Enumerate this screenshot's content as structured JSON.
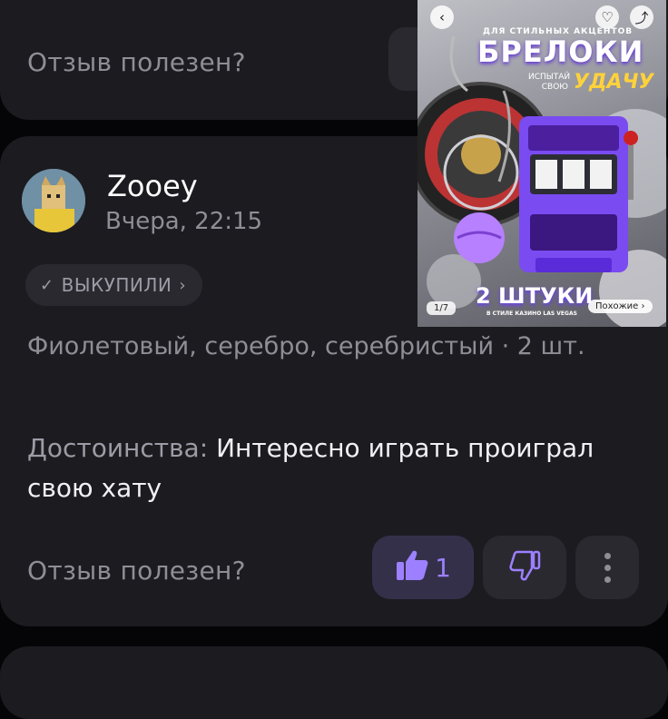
{
  "top_card": {
    "helpful_question": "Отзыв полезен?"
  },
  "review": {
    "author": "Zooey",
    "date": "Вчера, 22:15",
    "badge": {
      "icon": "check-icon",
      "label": "ВЫКУПИЛИ",
      "arrow": "chevron-right-icon"
    },
    "variant": "Фиолетовый, серебро, серебристый · 2 шт.",
    "pros_label": "Достоинства:",
    "pros_text": "Интересно играть проиграл свою хату",
    "helpful_question": "Отзыв полезен?",
    "like_count": "1",
    "icons": {
      "like": "thumbs-up-icon",
      "dislike": "thumbs-down-icon",
      "more": "more-vertical-icon"
    }
  },
  "product_preview": {
    "subtitle": "ДЛЯ СТИЛЬНЫХ АКЦЕНТОВ",
    "title": "БРЕЛОКИ",
    "try_text": "ИСПЫТАЙ СВОЮ",
    "brand_word": "УДАЧУ",
    "count_title": "2 ШТУКИ",
    "count_subtitle": "В СТИЛЕ КАЗИНО LAS VEGAS",
    "pager": "1/7",
    "similar_button": "Похожие ›",
    "icons": {
      "back": "chevron-left-icon",
      "favorite": "heart-icon",
      "share": "share-icon"
    }
  },
  "colors": {
    "background": "#050507",
    "card": "#1c1b20",
    "button": "#2a2930",
    "accent": "#9c80ff",
    "muted_text": "#8f8e96"
  }
}
